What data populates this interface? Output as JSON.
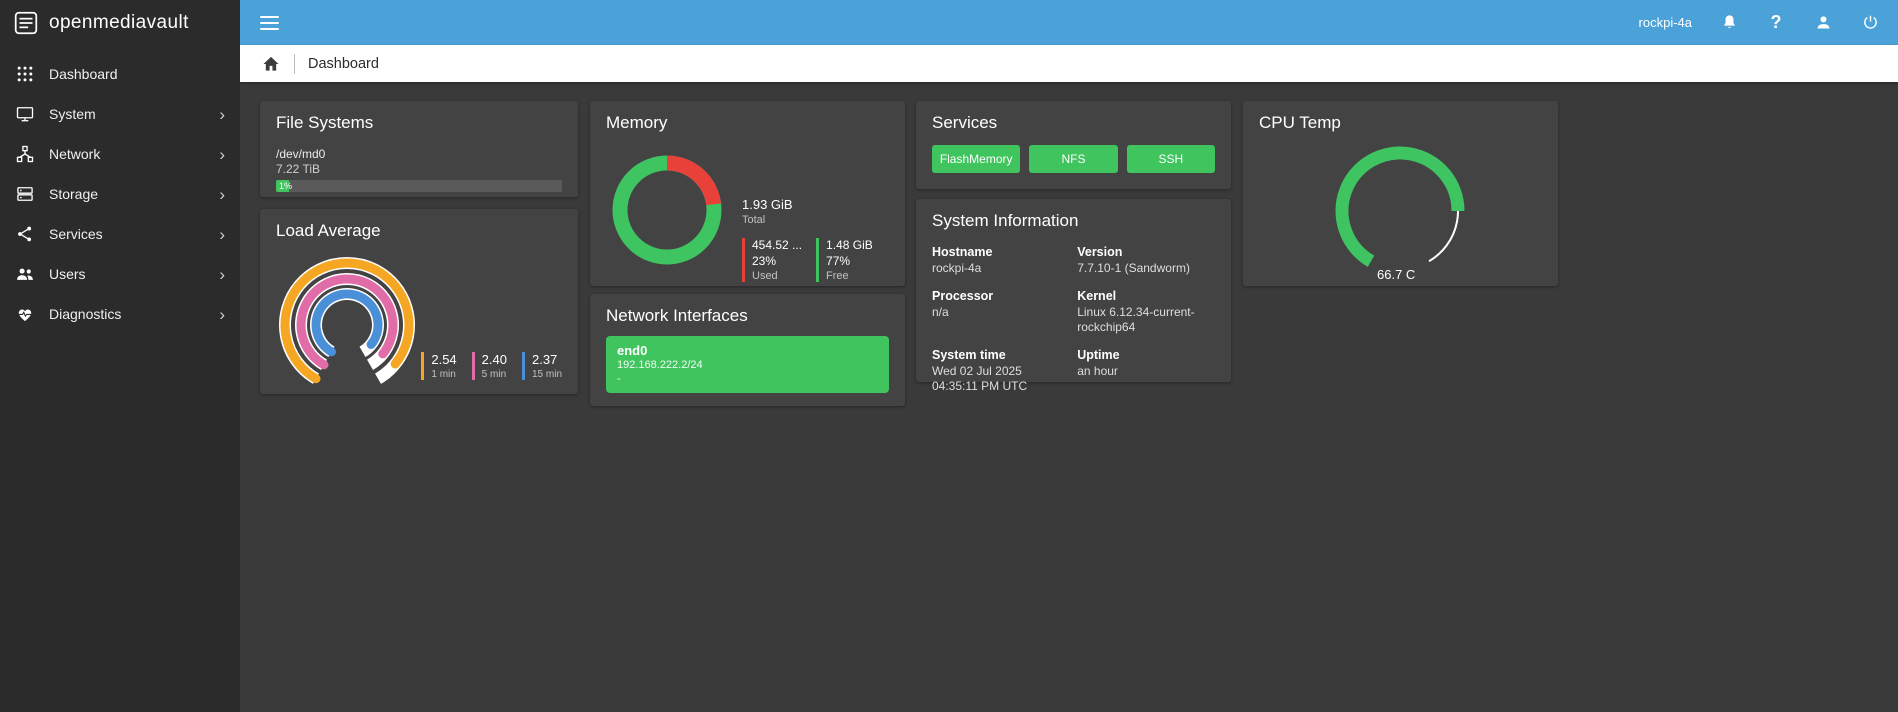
{
  "sidebar": {
    "logo_text": "openmediavault",
    "chevron_glyph": "›",
    "items": [
      {
        "label": "Dashboard",
        "icon": "dashboard-icon",
        "has_chevron": false
      },
      {
        "label": "System",
        "icon": "system-icon",
        "has_chevron": true
      },
      {
        "label": "Network",
        "icon": "network-icon",
        "has_chevron": true
      },
      {
        "label": "Storage",
        "icon": "storage-icon",
        "has_chevron": true
      },
      {
        "label": "Services",
        "icon": "services-icon",
        "has_chevron": true
      },
      {
        "label": "Users",
        "icon": "users-icon",
        "has_chevron": true
      },
      {
        "label": "Diagnostics",
        "icon": "diagnostics-icon",
        "has_chevron": true
      }
    ]
  },
  "topbar": {
    "hostname": "rockpi-4a",
    "help_glyph": "?",
    "color": "#4ba2d9",
    "icons": [
      "bell-icon",
      "help-icon",
      "user-icon",
      "power-icon"
    ]
  },
  "breadcrumb": {
    "title": "Dashboard"
  },
  "colors": {
    "accent_green": "#40c45e",
    "status_red": "#e8413a",
    "load_1min": "#f5a623",
    "load_5min": "#e06ca8",
    "load_15min": "#4a90d9"
  },
  "widgets": {
    "filesystems": {
      "title": "File Systems",
      "device": "/dev/md0",
      "size": "7.22 TiB",
      "percent": "1%"
    },
    "load": {
      "title": "Load Average",
      "items": [
        {
          "value": "2.54",
          "label": "1 min",
          "color": "#f5a623"
        },
        {
          "value": "2.40",
          "label": "5 min",
          "color": "#e06ca8"
        },
        {
          "value": "2.37",
          "label": "15 min",
          "color": "#4a90d9"
        }
      ]
    },
    "memory": {
      "title": "Memory",
      "total_value": "1.93 GiB",
      "total_label": "Total",
      "used_value": "454.52 ...",
      "used_percent": "23%",
      "used_label": "Used",
      "free_value": "1.48 GiB",
      "free_percent": "77%",
      "free_label": "Free"
    },
    "network": {
      "title": "Network Interfaces",
      "interface": "end0",
      "address": "192.168.222.2/24",
      "detail": "-"
    },
    "services": {
      "title": "Services",
      "items": [
        "FlashMemory",
        "NFS",
        "SSH"
      ]
    },
    "sysinfo": {
      "title": "System Information",
      "fields": [
        {
          "label": "Hostname",
          "value": "rockpi-4a"
        },
        {
          "label": "Version",
          "value": "7.7.10-1 (Sandworm)"
        },
        {
          "label": "Processor",
          "value": "n/a"
        },
        {
          "label": "Kernel",
          "value": "Linux 6.12.34-current-rockchip64"
        },
        {
          "label": "System time",
          "value": "Wed 02 Jul 2025 04:35:11 PM UTC"
        },
        {
          "label": "Uptime",
          "value": "an hour"
        }
      ]
    },
    "cputemp": {
      "title": "CPU Temp",
      "value": "66.7 C"
    }
  }
}
